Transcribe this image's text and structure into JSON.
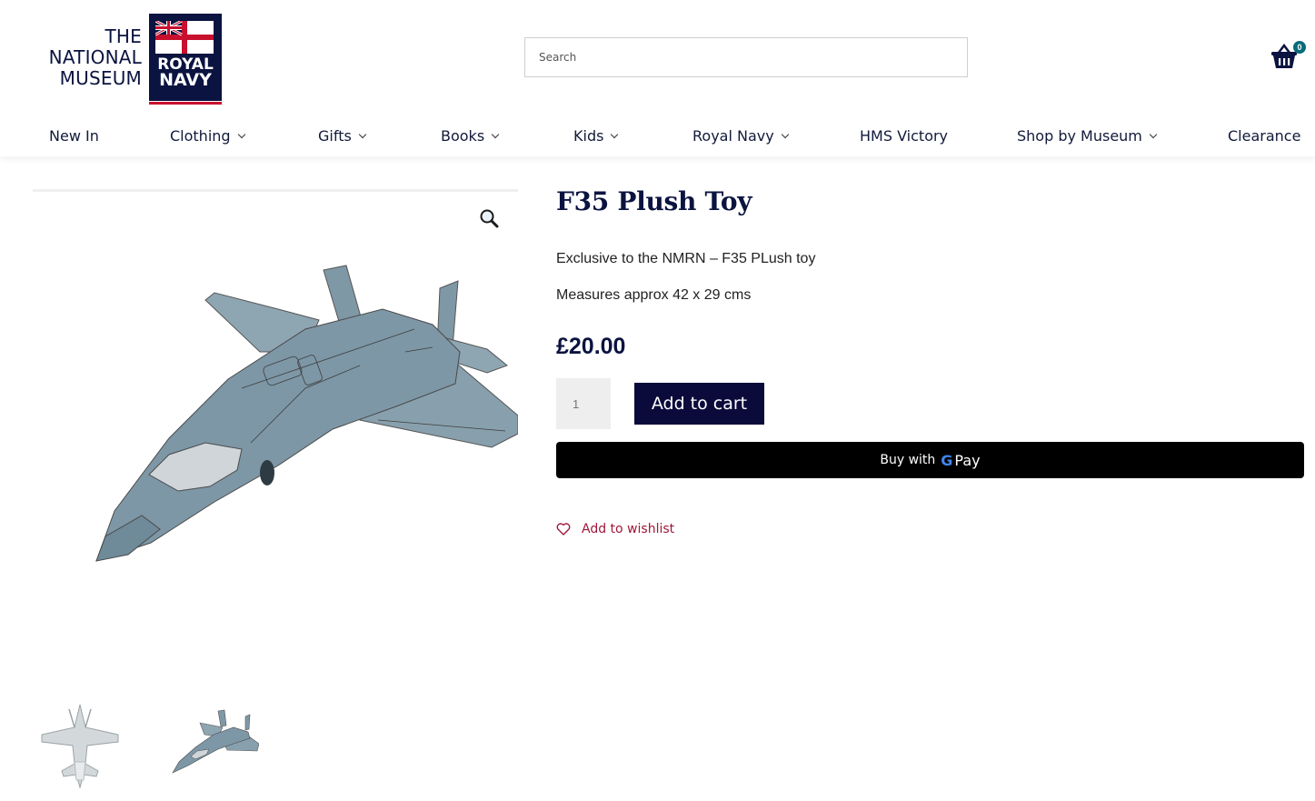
{
  "header": {
    "logo": {
      "line1": "THE",
      "line2": "NATIONAL",
      "line3": "MUSEUM",
      "badge_line1": "ROYAL",
      "badge_line2": "NAVY"
    },
    "search_placeholder": "Search",
    "cart_count": "0",
    "cart_icon": "basket-icon"
  },
  "nav": {
    "items": [
      {
        "label": "New In",
        "has_dropdown": false
      },
      {
        "label": "Clothing",
        "has_dropdown": true
      },
      {
        "label": "Gifts",
        "has_dropdown": true
      },
      {
        "label": "Books",
        "has_dropdown": true
      },
      {
        "label": "Kids",
        "has_dropdown": true
      },
      {
        "label": "Royal Navy",
        "has_dropdown": true
      },
      {
        "label": "HMS Victory",
        "has_dropdown": false
      },
      {
        "label": "Shop by Museum",
        "has_dropdown": true
      },
      {
        "label": "Clearance",
        "has_dropdown": false
      }
    ]
  },
  "product": {
    "title": "F35 Plush Toy",
    "description": [
      "Exclusive to the NMRN – F35 PLush toy",
      "Measures approx 42 x 29 cms"
    ],
    "price": "£20.00",
    "quantity": "1",
    "add_to_cart_label": "Add to cart",
    "gpay": {
      "prefix": "Buy with",
      "g": "G",
      "pay": "Pay"
    },
    "wishlist_label": "Add to wishlist"
  },
  "gallery": {
    "zoom_icon": "magnifier-icon",
    "main_image": "f35-plush-toy-angle",
    "thumbnails": [
      "f35-plush-toy-top",
      "f35-plush-toy-angle"
    ]
  },
  "colors": {
    "navy": "#0b1340",
    "button": "#0b0b3b",
    "wishlist": "#a0163a",
    "cart_badge": "#0a6b7a",
    "plane": "#7d97a6"
  }
}
